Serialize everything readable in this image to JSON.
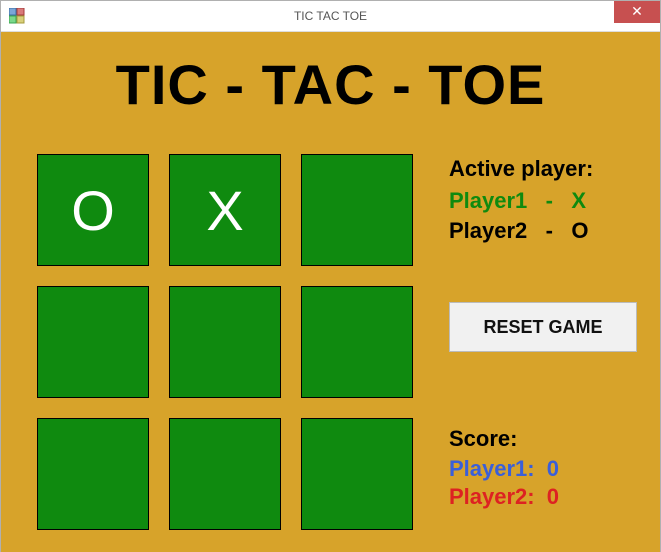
{
  "window": {
    "title": "TIC TAC TOE",
    "close_glyph": "✕"
  },
  "game": {
    "title": "TIC - TAC - TOE"
  },
  "board": {
    "cells": [
      "O",
      "X",
      "",
      "",
      "",
      "",
      "",
      "",
      ""
    ]
  },
  "side": {
    "active_label": "Active player:",
    "player1": {
      "name": "Player1",
      "separator": "-",
      "mark": "X"
    },
    "player2": {
      "name": "Player2",
      "separator": "-",
      "mark": "O"
    }
  },
  "reset": {
    "label": "RESET GAME"
  },
  "score": {
    "label": "Score:",
    "player1": {
      "name": "Player1:",
      "value": "0"
    },
    "player2": {
      "name": "Player2:",
      "value": "0"
    }
  },
  "colors": {
    "client_bg": "#d7a32a",
    "cell_bg": "#0f8a0f",
    "p1_active": "#0f8a0f",
    "score_p1": "#3a5fd9",
    "score_p2": "#d22",
    "close_bg": "#c75050"
  }
}
